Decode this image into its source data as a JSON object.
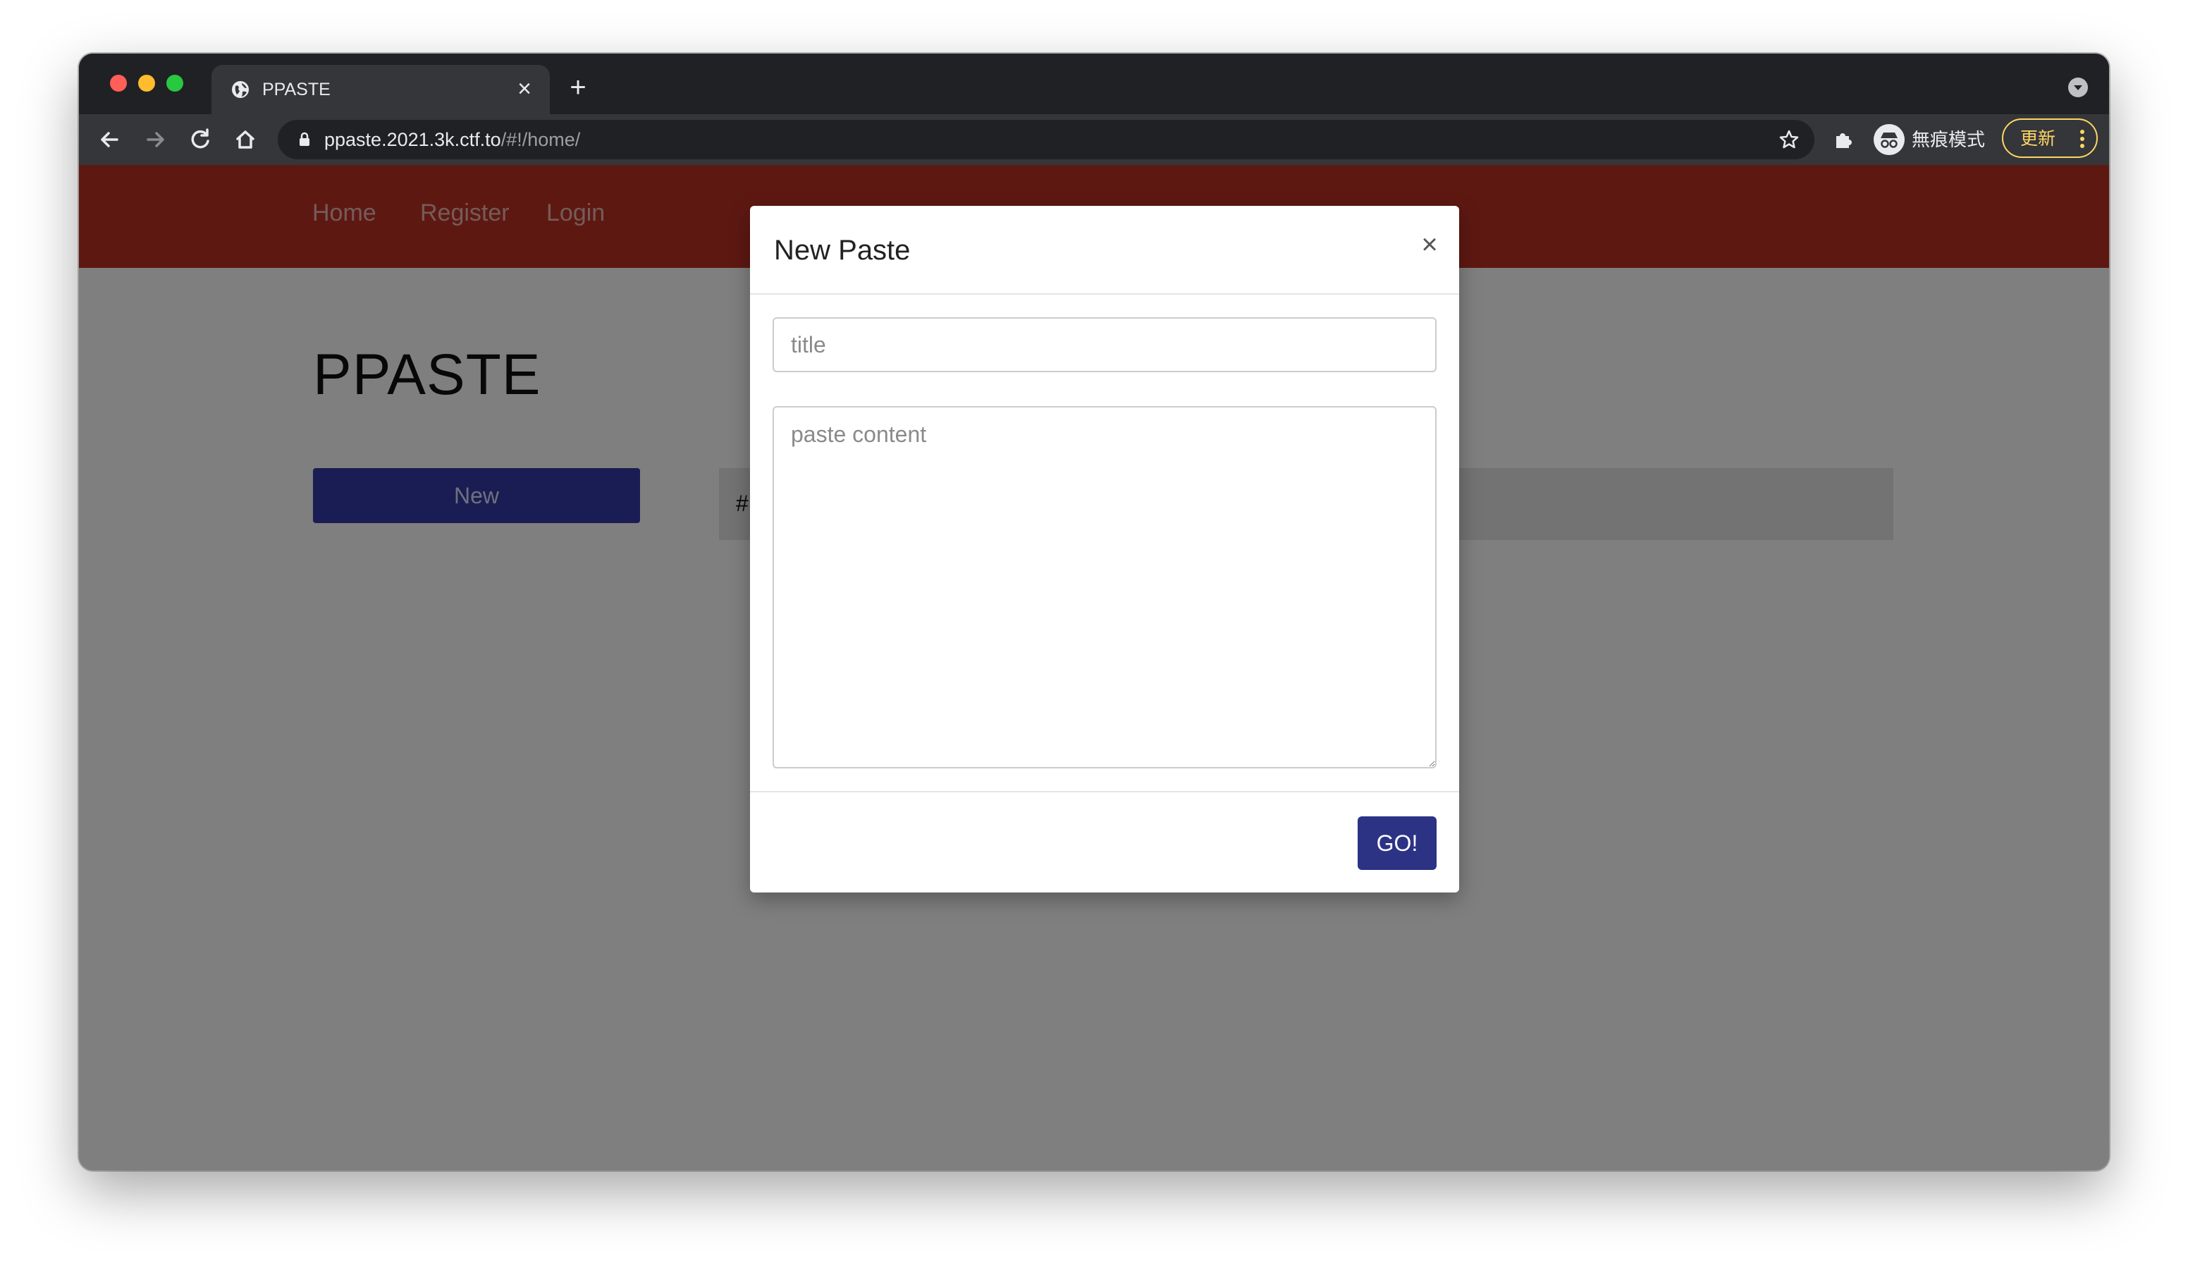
{
  "browser": {
    "tab": {
      "title": "PPASTE",
      "close_glyph": "×"
    },
    "new_tab_glyph": "+",
    "address": {
      "host": "ppaste.2021.3k.ctf.to",
      "path": "/#!/home/"
    },
    "profile_label": "無痕模式",
    "update_label": "更新",
    "icons": [
      "globe-icon",
      "back-icon",
      "forward-icon",
      "reload-icon",
      "home-icon",
      "lock-icon",
      "star-icon",
      "puzzle-icon",
      "incognito-icon",
      "more-icon",
      "tab-search-icon"
    ]
  },
  "site": {
    "nav": [
      {
        "label": "Home"
      },
      {
        "label": "Register"
      },
      {
        "label": "Login"
      }
    ],
    "brand": "PPASTE",
    "new_button": "New",
    "list_header": "#",
    "nav_color": "#bd3025",
    "accent_color": "#343aa6"
  },
  "modal": {
    "title": "New Paste",
    "close_glyph": "×",
    "title_placeholder": "title",
    "title_value": "",
    "content_placeholder": "paste content",
    "content_value": "",
    "submit_label": "GO!"
  }
}
